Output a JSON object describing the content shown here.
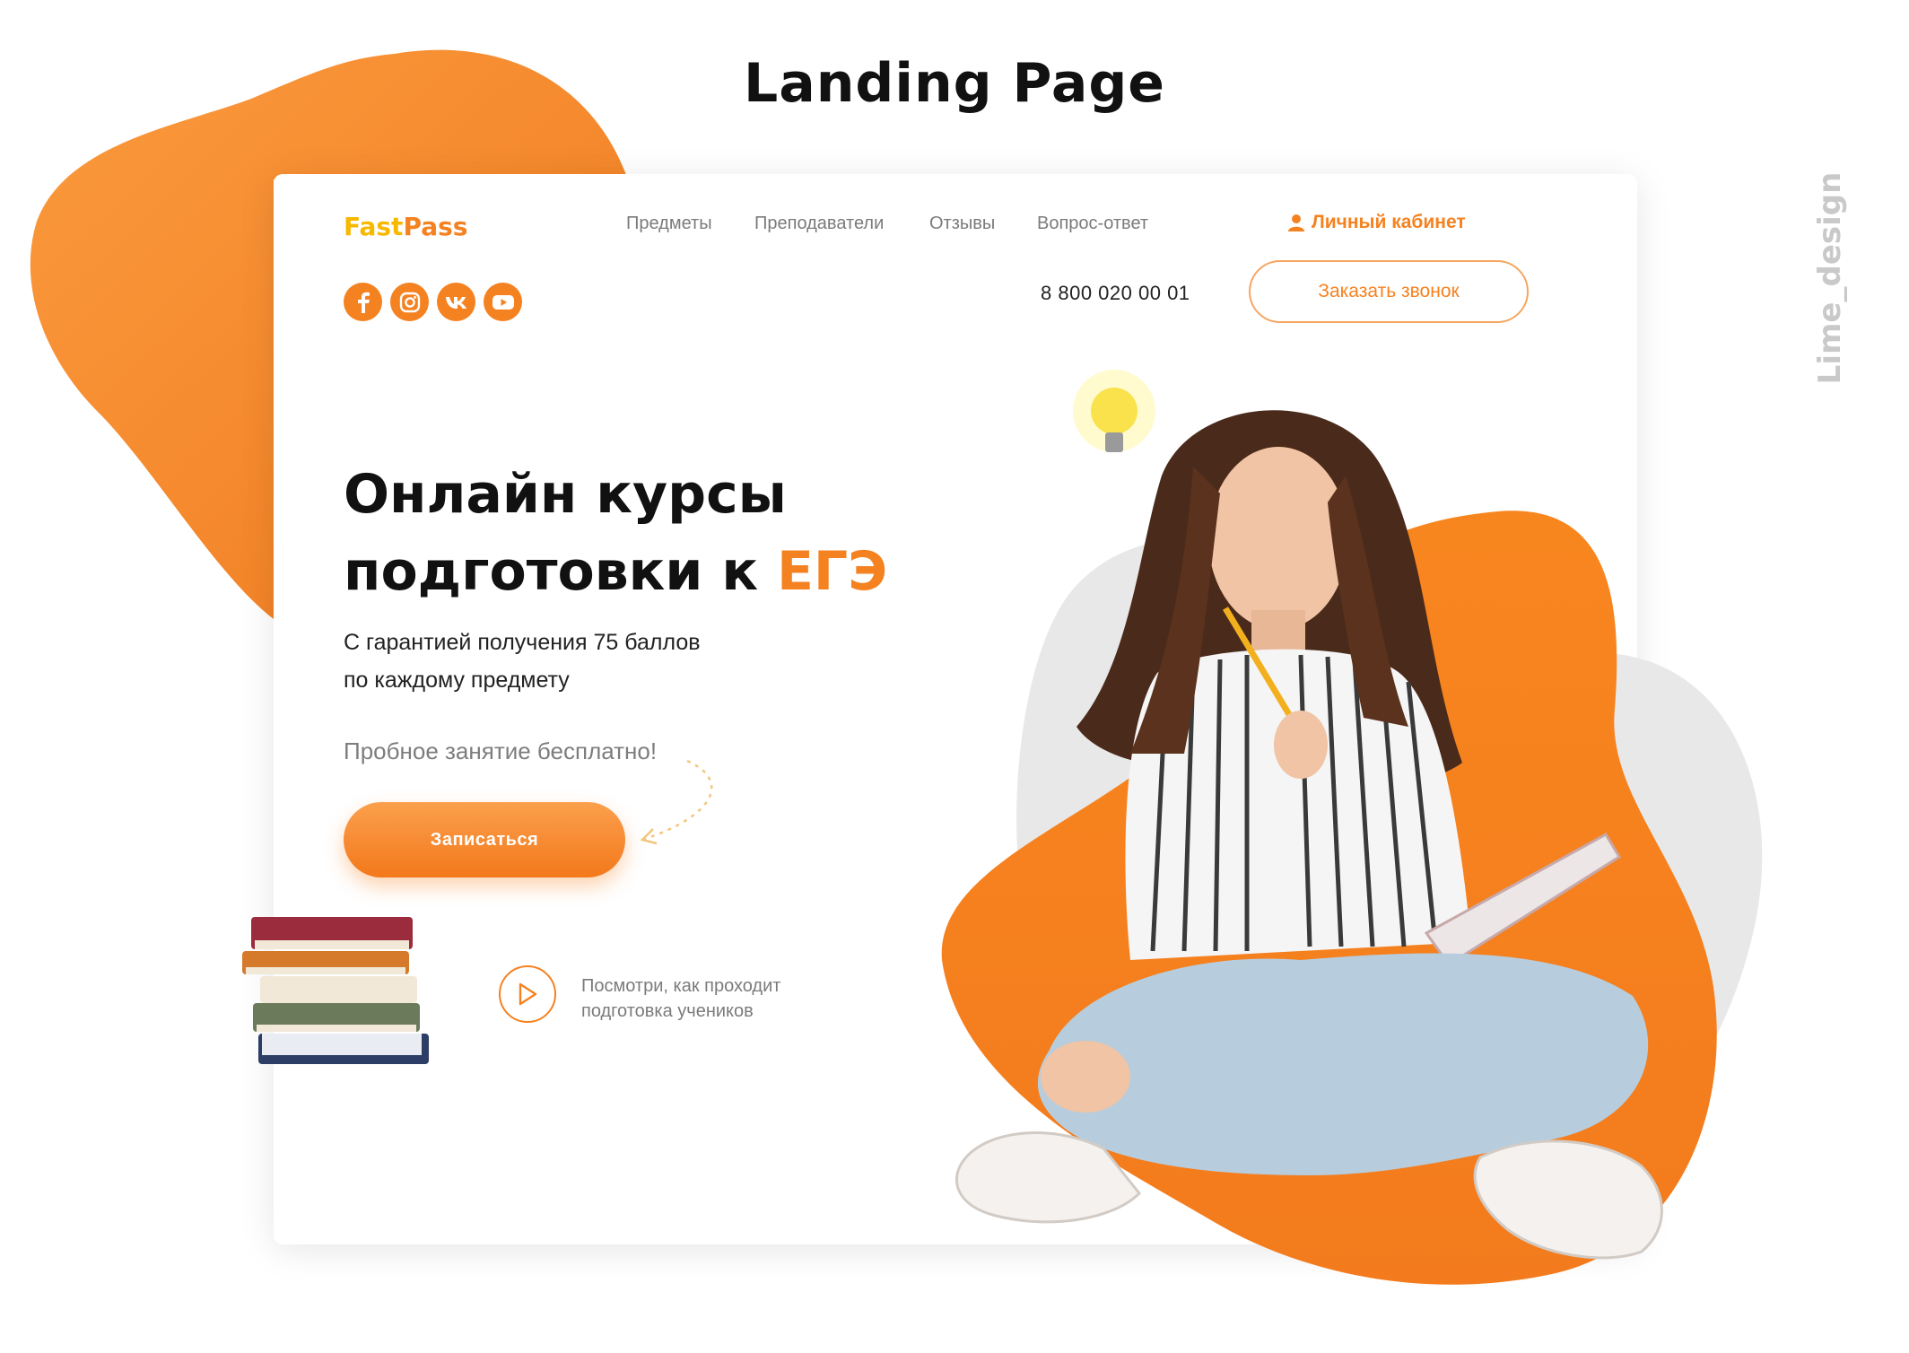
{
  "page_heading": "Landing Page",
  "watermark": "Lime_design",
  "header": {
    "logo": {
      "part1": "Fast",
      "part2": "Pass"
    },
    "nav": [
      {
        "label": "Предметы"
      },
      {
        "label": "Преподаватели"
      },
      {
        "label": "Отзывы"
      },
      {
        "label": "Вопрос-ответ"
      }
    ],
    "cabinet_label": "Личный кабинет",
    "phone": "8 800 020 00 01",
    "callback_label": "Заказать звонок",
    "socials": [
      "facebook-icon",
      "instagram-icon",
      "vk-icon",
      "youtube-icon"
    ]
  },
  "hero": {
    "title_line1": "Онлайн курсы",
    "title_line2": "подготовки к ",
    "title_accent": "ЕГЭ",
    "subtitle_line1": "С гарантией получения 75 баллов",
    "subtitle_line2": "по  каждому предмету",
    "trial_text": "Пробное занятие бесплатно!",
    "signup_label": "Записаться",
    "video_text_line1": "Посмотри, как проходит",
    "video_text_line2": "подготовка учеников"
  },
  "colors": {
    "accent": "#f58220",
    "logo_yellow": "#f7b800",
    "text_dark": "#111111",
    "text_muted": "#7b7b7b"
  }
}
